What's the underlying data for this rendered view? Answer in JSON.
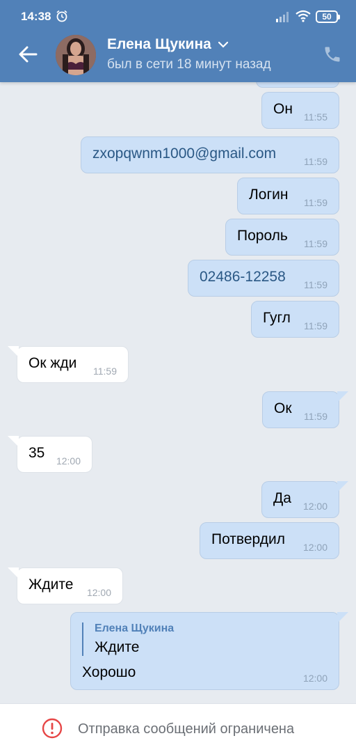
{
  "status_bar": {
    "time": "14:38",
    "battery": "50"
  },
  "header": {
    "contact_name": "Елена Щукина",
    "last_seen": "был в сети 18 минут назад"
  },
  "messages": [
    {
      "direction": "out",
      "text": "",
      "time": ""
    },
    {
      "direction": "out",
      "text": "Он",
      "time": "11:55"
    },
    {
      "direction": "out",
      "text": "zxopqwnm1000@gmail.com",
      "time": "11:59"
    },
    {
      "direction": "out",
      "text": "Логин",
      "time": "11:59"
    },
    {
      "direction": "out",
      "text": "Пороль",
      "time": "11:59"
    },
    {
      "direction": "out",
      "text": "02486-12258",
      "time": "11:59"
    },
    {
      "direction": "out",
      "text": "Гугл",
      "time": "11:59"
    },
    {
      "direction": "in",
      "text": "Ок жди",
      "time": "11:59"
    },
    {
      "direction": "out",
      "text": "Ок",
      "time": "11:59"
    },
    {
      "direction": "in",
      "text": "35",
      "time": "12:00"
    },
    {
      "direction": "out",
      "text": "Да",
      "time": "12:00"
    },
    {
      "direction": "out",
      "text": "Потвердил",
      "time": "12:00"
    },
    {
      "direction": "in",
      "text": "Ждите",
      "time": "12:00"
    },
    {
      "direction": "out",
      "text": "Хорошо",
      "time": "12:00",
      "reply": {
        "author": "Елена Щукина",
        "text": "Ждите"
      }
    }
  ],
  "bottom_bar": {
    "restriction": "Отправка сообщений ограничена"
  },
  "colors": {
    "header": "#5181b8",
    "outgoing_bubble": "#cce0f7",
    "incoming_bubble": "#ffffff",
    "background": "#e7ebf0"
  }
}
